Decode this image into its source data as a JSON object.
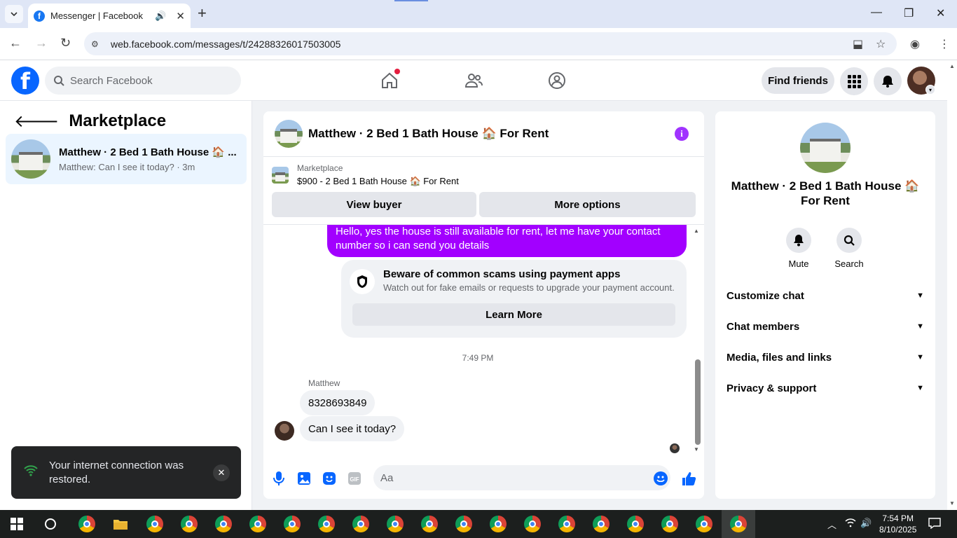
{
  "browser": {
    "tab_title": "Messenger | Facebook",
    "url": "web.facebook.com/messages/t/24288326017503005"
  },
  "fb": {
    "search_placeholder": "Search Facebook",
    "find_friends": "Find friends"
  },
  "left": {
    "title": "Marketplace",
    "conversation": {
      "name": "Matthew · 2 Bed 1 Bath House 🏠 ...",
      "last_message": "Matthew: Can I see it today? · 3m"
    }
  },
  "toast": {
    "message": "Your internet connection was restored."
  },
  "chat": {
    "title": "Matthew · 2 Bed 1 Bath House 🏠 For Rent",
    "marketplace_label": "Marketplace",
    "listing": "$900 - 2 Bed 1 Bath House 🏠 For Rent",
    "view_buyer": "View buyer",
    "more_options": "More options",
    "my_message": "Hello, yes the house is still available for rent, let me have your contact number so i can send you  details",
    "scam_title": "Beware of common scams using payment apps",
    "scam_text": "Watch out for fake emails or requests to upgrade your payment account.",
    "learn_more": "Learn More",
    "timestamp": "7:49 PM",
    "sender": "Matthew",
    "their_messages": [
      "8328693849",
      "Can I see it today?"
    ],
    "composer_placeholder": "Aa"
  },
  "right": {
    "name": "Matthew · 2 Bed 1 Bath House 🏠 For Rent",
    "mute": "Mute",
    "search": "Search",
    "sections": [
      "Customize chat",
      "Chat members",
      "Media, files and links",
      "Privacy & support"
    ]
  },
  "taskbar": {
    "time": "7:54 PM",
    "date": "8/10/2025"
  },
  "colors": {
    "fb_blue": "#0866ff",
    "bubble_purple": "#a200ff",
    "info_purple": "#a033ff"
  }
}
